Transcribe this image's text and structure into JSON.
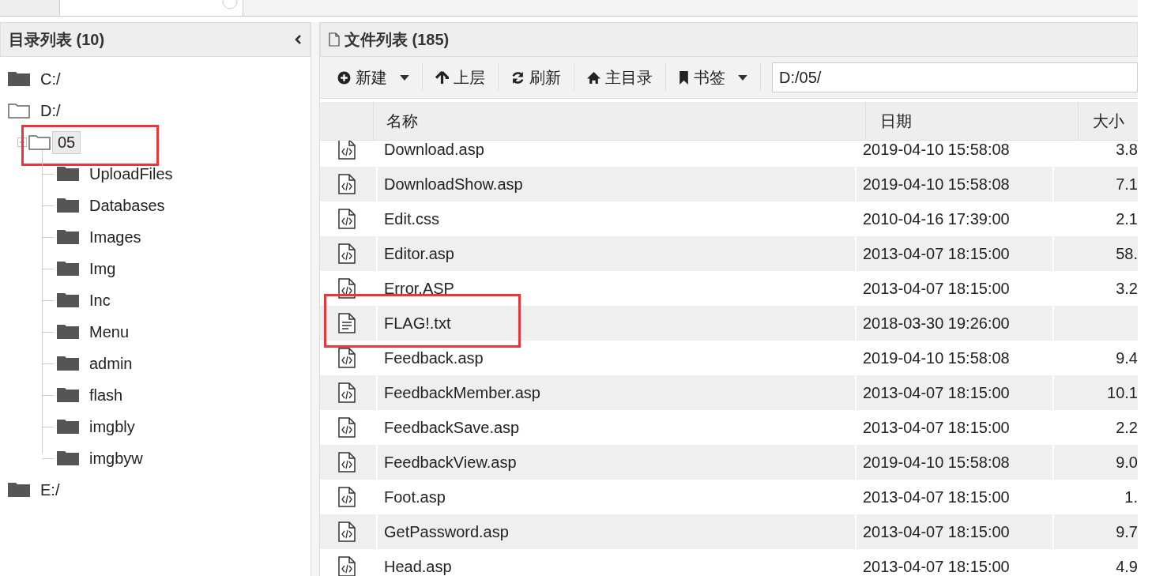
{
  "left_panel": {
    "title": "目录列表 (10)"
  },
  "tree": [
    {
      "label": "C:/",
      "expanded": false,
      "selected": false
    },
    {
      "label": "D:/",
      "expanded": true,
      "selected": false,
      "children": [
        {
          "label": "05",
          "expanded": true,
          "selected": true,
          "annotated": true,
          "children": [
            {
              "label": "UploadFiles",
              "expanded": false,
              "selected": false
            },
            {
              "label": "Databases",
              "expanded": false,
              "selected": false
            },
            {
              "label": "Images",
              "expanded": false,
              "selected": false
            },
            {
              "label": "Img",
              "expanded": false,
              "selected": false
            },
            {
              "label": "Inc",
              "expanded": false,
              "selected": false
            },
            {
              "label": "Menu",
              "expanded": false,
              "selected": false
            },
            {
              "label": "admin",
              "expanded": false,
              "selected": false
            },
            {
              "label": "flash",
              "expanded": false,
              "selected": false
            },
            {
              "label": "imgbly",
              "expanded": false,
              "selected": false
            },
            {
              "label": "imgbyw",
              "expanded": false,
              "selected": false
            }
          ]
        }
      ]
    },
    {
      "label": "E:/",
      "expanded": false,
      "selected": false
    }
  ],
  "right_panel": {
    "title": "文件列表 (185)"
  },
  "toolbar": [
    {
      "label": "新建",
      "dropdown": true
    },
    {
      "label": "上层",
      "dropdown": false
    },
    {
      "label": "刷新",
      "dropdown": false
    },
    {
      "label": "主目录",
      "dropdown": false
    },
    {
      "label": "书签",
      "dropdown": true
    }
  ],
  "path_field": {
    "value": "D:/05/"
  },
  "table": {
    "columns": [
      "名称",
      "日期",
      "大小"
    ],
    "rows": [
      {
        "kind": "code",
        "name": "Download.asp",
        "date": "2019-04-10 15:58:08",
        "size": "3.8",
        "annotated": false
      },
      {
        "kind": "code",
        "name": "DownloadShow.asp",
        "date": "2019-04-10 15:58:08",
        "size": "7.1",
        "annotated": false
      },
      {
        "kind": "code",
        "name": "Edit.css",
        "date": "2010-04-16 17:39:00",
        "size": "2.1",
        "annotated": false
      },
      {
        "kind": "code",
        "name": "Editor.asp",
        "date": "2013-04-07 18:15:00",
        "size": "58.",
        "annotated": false
      },
      {
        "kind": "code",
        "name": "Error.ASP",
        "date": "2013-04-07 18:15:00",
        "size": "3.2",
        "annotated": false
      },
      {
        "kind": "text",
        "name": "FLAG!.txt",
        "date": "2018-03-30 19:26:00",
        "annotated": true
      },
      {
        "kind": "code",
        "name": "Feedback.asp",
        "date": "2019-04-10 15:58:08",
        "size": "9.4",
        "annotated": false
      },
      {
        "kind": "code",
        "name": "FeedbackMember.asp",
        "date": "2013-04-07 18:15:00",
        "size": "10.1",
        "annotated": false
      },
      {
        "kind": "code",
        "name": "FeedbackSave.asp",
        "date": "2013-04-07 18:15:00",
        "size": "2.2",
        "annotated": false
      },
      {
        "kind": "code",
        "name": "FeedbackView.asp",
        "date": "2019-04-10 15:58:08",
        "size": "9.0",
        "annotated": false
      },
      {
        "kind": "code",
        "name": "Foot.asp",
        "date": "2013-04-07 18:15:00",
        "size": "1.",
        "annotated": false
      },
      {
        "kind": "code",
        "name": "GetPassword.asp",
        "date": "2013-04-07 18:15:00",
        "size": "9.7",
        "annotated": false
      },
      {
        "kind": "code",
        "name": "Head.asp",
        "date": "2013-04-07 18:15:00",
        "size": "4.9",
        "annotated": false
      }
    ]
  }
}
